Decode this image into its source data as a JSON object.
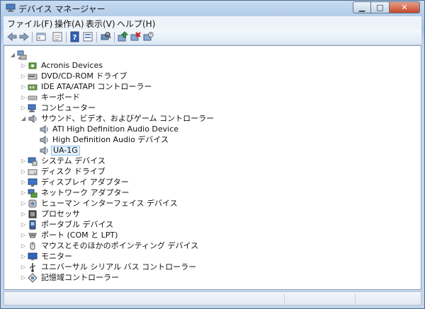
{
  "window": {
    "title": "デバイス マネージャー"
  },
  "menu": [
    "ファイル(F)",
    "操作(A)",
    "表示(V)",
    "ヘルプ(H)"
  ],
  "toolbar": [
    "back-icon",
    "forward-icon",
    "show-hide-icon",
    "properties-icon",
    "help-icon",
    "view-icon",
    "scan-hardware-icon",
    "update-driver-icon",
    "uninstall-icon",
    "disable-icon"
  ],
  "tree": {
    "root_label": "",
    "items": [
      {
        "label": "Acronis Devices",
        "icon": "device-icon",
        "expanded": false
      },
      {
        "label": "DVD/CD-ROM ドライブ",
        "icon": "dvd-icon",
        "expanded": false
      },
      {
        "label": "IDE ATA/ATAPI コントローラー",
        "icon": "ide-icon",
        "expanded": false
      },
      {
        "label": "キーボード",
        "icon": "keyboard-icon",
        "expanded": false
      },
      {
        "label": "コンピューター",
        "icon": "computer-icon",
        "expanded": false
      },
      {
        "label": "サウンド、ビデオ、およびゲーム コントローラー",
        "icon": "sound-icon",
        "expanded": true,
        "children": [
          {
            "label": "ATI High Definition Audio Device",
            "icon": "speaker-icon"
          },
          {
            "label": "High Definition Audio デバイス",
            "icon": "speaker-icon"
          },
          {
            "label": "UA-1G",
            "icon": "speaker-icon",
            "selected": true
          }
        ]
      },
      {
        "label": "システム デバイス",
        "icon": "system-icon",
        "expanded": false
      },
      {
        "label": "ディスク ドライブ",
        "icon": "disk-icon",
        "expanded": false
      },
      {
        "label": "ディスプレイ アダプター",
        "icon": "display-icon",
        "expanded": false
      },
      {
        "label": "ネットワーク アダプター",
        "icon": "network-icon",
        "expanded": false
      },
      {
        "label": "ヒューマン インターフェイス デバイス",
        "icon": "hid-icon",
        "expanded": false
      },
      {
        "label": "プロセッサ",
        "icon": "processor-icon",
        "expanded": false
      },
      {
        "label": "ポータブル デバイス",
        "icon": "portable-icon",
        "expanded": false
      },
      {
        "label": "ポート (COM と LPT)",
        "icon": "port-icon",
        "expanded": false
      },
      {
        "label": "マウスとそのほかのポインティング デバイス",
        "icon": "mouse-icon",
        "expanded": false
      },
      {
        "label": "モニター",
        "icon": "monitor-icon",
        "expanded": false
      },
      {
        "label": "ユニバーサル シリアル バス コントローラー",
        "icon": "usb-icon",
        "expanded": false
      },
      {
        "label": "記憶域コントローラー",
        "icon": "storage-icon",
        "expanded": false
      }
    ]
  }
}
